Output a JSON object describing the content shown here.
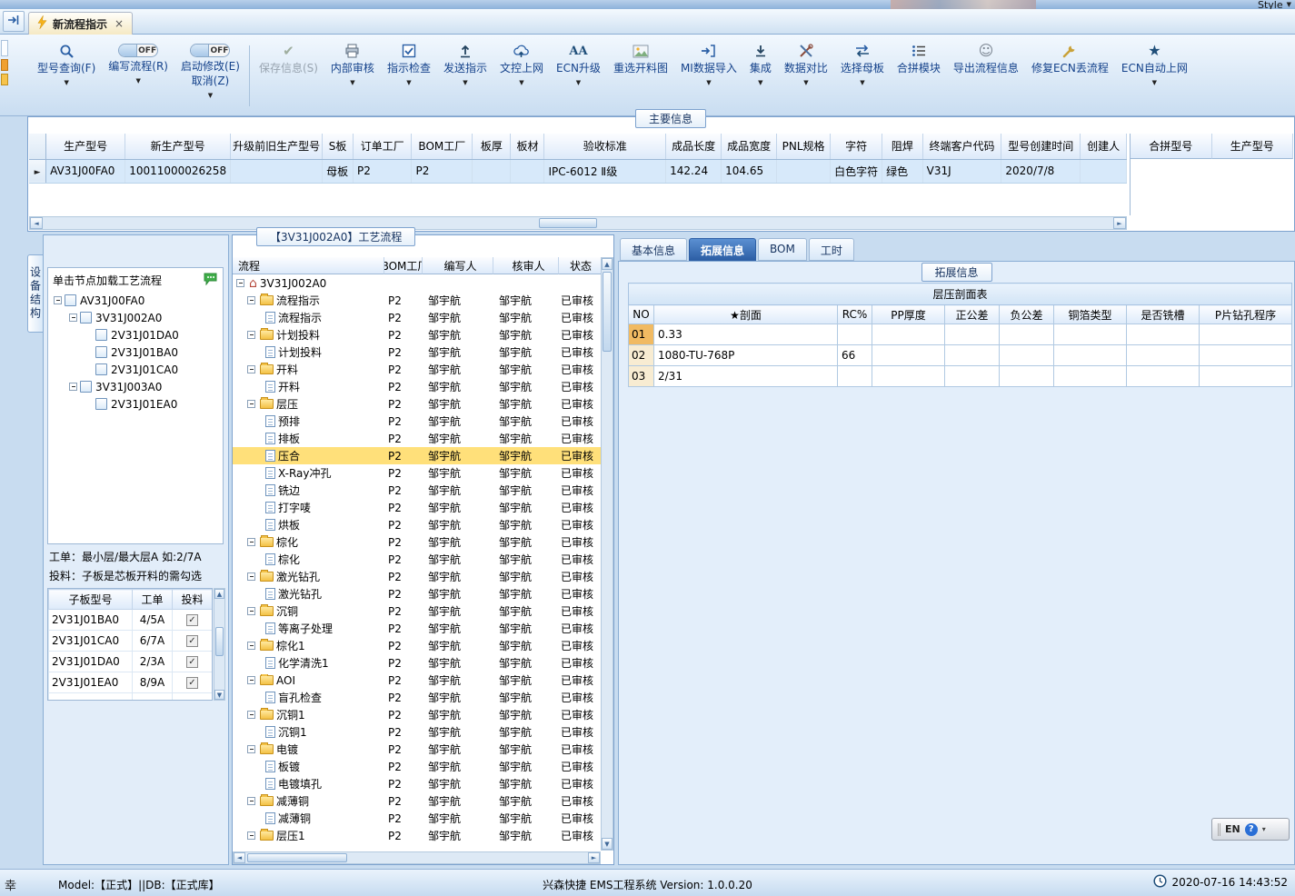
{
  "colors": {
    "accent_blue": "#2d5fa5",
    "panel_border": "#7da2ce",
    "toolbar_text": "#15428b",
    "selection_yellow": "#ffe07a",
    "active_tab_blue": "#3b6db0",
    "no_cell_orange": "#f1ba62",
    "comment_green": "#3fae49"
  },
  "icons": {
    "lightning-icon": "bolt",
    "comment-icon": "speech-bubble",
    "clock-icon": "clock",
    "chevron-down-icon": "▼",
    "row-marker-icon": "►"
  },
  "window": {
    "style_label": "Style"
  },
  "tab_bar": {
    "active_tab": "新流程指示",
    "close_icon": "×"
  },
  "toolbar": {
    "buttons": [
      {
        "id": "model-query",
        "label": "型号查询(F)",
        "icon": "search-icon",
        "dropdown": true
      },
      {
        "id": "write-flow",
        "label": "编写流程(R)",
        "toggle": "OFF",
        "dropdown": true
      },
      {
        "id": "start-modify",
        "label": "启动修改(E)",
        "label2": "取消(Z)",
        "toggle": "OFF",
        "dropdown": true,
        "sep_after": true
      },
      {
        "id": "save-info",
        "label": "保存信息(S)",
        "icon": "save-check-icon",
        "disabled": true
      },
      {
        "id": "internal-audit",
        "label": "内部审核",
        "icon": "printer-icon",
        "dropdown": true
      },
      {
        "id": "instruction-check",
        "label": "指示检查",
        "icon": "checkbox-icon",
        "dropdown": true
      },
      {
        "id": "send-instruction",
        "label": "发送指示",
        "icon": "upload-icon",
        "dropdown": true
      },
      {
        "id": "doc-upload",
        "label": "文控上网",
        "icon": "cloud-upload-icon",
        "dropdown": true
      },
      {
        "id": "ecn-upgrade",
        "label": "ECN升级",
        "icon": "font-icon",
        "dropdown": true
      },
      {
        "id": "reselect-cut-image",
        "label": "重选开料图",
        "icon": "image-icon"
      },
      {
        "id": "mi-data-import",
        "label": "MI数据导入",
        "icon": "import-icon",
        "dropdown": true
      },
      {
        "id": "integrate",
        "label": "集成",
        "icon": "download-icon",
        "dropdown": true
      },
      {
        "id": "data-compare",
        "label": "数据对比",
        "icon": "tools-icon",
        "dropdown": true
      },
      {
        "id": "select-mother-board",
        "label": "选择母板",
        "icon": "swap-icon",
        "dropdown": true
      },
      {
        "id": "merge-module",
        "label": "合拼模块",
        "icon": "list-icon"
      },
      {
        "id": "export-flow-info",
        "label": "导出流程信息",
        "icon": "smiley-icon"
      },
      {
        "id": "repair-ecn-flow",
        "label": "修复ECN丢流程",
        "icon": "wrench-icon"
      },
      {
        "id": "ecn-auto-upload",
        "label": "ECN自动上网",
        "icon": "star-icon",
        "dropdown": true
      }
    ]
  },
  "main_info": {
    "caption": "主要信息",
    "columns": [
      "生产型号",
      "新生产型号",
      "升级前旧生产型号",
      "S板",
      "订单工厂",
      "BOM工厂",
      "板厚",
      "板材",
      "验收标准",
      "成品长度",
      "成品宽度",
      "PNL规格",
      "字符",
      "阻焊",
      "终端客户代码",
      "型号创建时间",
      "创建人"
    ],
    "row": [
      "AV31J00FA0",
      "10011000026258",
      "",
      "母板",
      "P2",
      "P2",
      "",
      "",
      "IPC-6012 Ⅱ级",
      "142.24",
      "104.65",
      "",
      "白色字符",
      "绿色",
      "V31J",
      "2020/7/8",
      ""
    ],
    "right_columns": [
      "合拼型号",
      "生产型号"
    ]
  },
  "device_panel": {
    "vertical_tab": "设备结构",
    "hint": "单击节点加载工艺流程",
    "tree": [
      {
        "label": "AV31J00FA0",
        "level": 0,
        "expanded": true
      },
      {
        "label": "3V31J002A0",
        "level": 1,
        "expanded": true
      },
      {
        "label": "2V31J01DA0",
        "level": 2
      },
      {
        "label": "2V31J01BA0",
        "level": 2
      },
      {
        "label": "2V31J01CA0",
        "level": 2
      },
      {
        "label": "3V31J003A0",
        "level": 1,
        "expanded": true
      },
      {
        "label": "2V31J01EA0",
        "level": 2
      }
    ],
    "notes": [
      "工单：最小层/最大层A 如:2/7A",
      "投料：子板是芯板开料的需勾选"
    ],
    "subboard_table": {
      "columns": [
        "子板型号",
        "工单",
        "投料"
      ],
      "rows": [
        {
          "model": "2V31J01BA0",
          "order": "4/5A",
          "feed": true
        },
        {
          "model": "2V31J01CA0",
          "order": "6/7A",
          "feed": true
        },
        {
          "model": "2V31J01DA0",
          "order": "2/3A",
          "feed": true
        },
        {
          "model": "2V31J01EA0",
          "order": "8/9A",
          "feed": true
        }
      ]
    }
  },
  "process_panel": {
    "caption": "【3V31J002A0】工艺流程",
    "columns": [
      "流程",
      "BOM工厂",
      "编写人",
      "核审人",
      "状态"
    ],
    "rows": [
      {
        "type": "root",
        "label": "3V31J002A0",
        "level": 0,
        "bom": "",
        "writer": "",
        "auditor": "",
        "status": ""
      },
      {
        "type": "folder",
        "label": "流程指示",
        "level": 1,
        "bom": "P2",
        "writer": "邹宇航",
        "auditor": "邹宇航",
        "status": "已审核"
      },
      {
        "type": "item",
        "label": "流程指示",
        "level": 2,
        "bom": "P2",
        "writer": "邹宇航",
        "auditor": "邹宇航",
        "status": "已审核"
      },
      {
        "type": "folder",
        "label": "计划投料",
        "level": 1,
        "bom": "P2",
        "writer": "邹宇航",
        "auditor": "邹宇航",
        "status": "已审核"
      },
      {
        "type": "item",
        "label": "计划投料",
        "level": 2,
        "bom": "P2",
        "writer": "邹宇航",
        "auditor": "邹宇航",
        "status": "已审核"
      },
      {
        "type": "folder",
        "label": "开料",
        "level": 1,
        "bom": "P2",
        "writer": "邹宇航",
        "auditor": "邹宇航",
        "status": "已审核"
      },
      {
        "type": "item",
        "label": "开料",
        "level": 2,
        "bom": "P2",
        "writer": "邹宇航",
        "auditor": "邹宇航",
        "status": "已审核"
      },
      {
        "type": "folder",
        "label": "层压",
        "level": 1,
        "bom": "P2",
        "writer": "邹宇航",
        "auditor": "邹宇航",
        "status": "已审核"
      },
      {
        "type": "item",
        "label": "预排",
        "level": 2,
        "bom": "P2",
        "writer": "邹宇航",
        "auditor": "邹宇航",
        "status": "已审核"
      },
      {
        "type": "item",
        "label": "排板",
        "level": 2,
        "bom": "P2",
        "writer": "邹宇航",
        "auditor": "邹宇航",
        "status": "已审核"
      },
      {
        "type": "item",
        "label": "压合",
        "level": 2,
        "selected": true,
        "bom": "P2",
        "writer": "邹宇航",
        "auditor": "邹宇航",
        "status": "已审核"
      },
      {
        "type": "item",
        "label": "X-Ray冲孔",
        "level": 2,
        "bom": "P2",
        "writer": "邹宇航",
        "auditor": "邹宇航",
        "status": "已审核"
      },
      {
        "type": "item",
        "label": "铣边",
        "level": 2,
        "bom": "P2",
        "writer": "邹宇航",
        "auditor": "邹宇航",
        "status": "已审核"
      },
      {
        "type": "item",
        "label": "打字唛",
        "level": 2,
        "bom": "P2",
        "writer": "邹宇航",
        "auditor": "邹宇航",
        "status": "已审核"
      },
      {
        "type": "item",
        "label": "烘板",
        "level": 2,
        "bom": "P2",
        "writer": "邹宇航",
        "auditor": "邹宇航",
        "status": "已审核"
      },
      {
        "type": "folder",
        "label": "棕化",
        "level": 1,
        "bom": "P2",
        "writer": "邹宇航",
        "auditor": "邹宇航",
        "status": "已审核"
      },
      {
        "type": "item",
        "label": "棕化",
        "level": 2,
        "bom": "P2",
        "writer": "邹宇航",
        "auditor": "邹宇航",
        "status": "已审核"
      },
      {
        "type": "folder",
        "label": "激光钻孔",
        "level": 1,
        "bom": "P2",
        "writer": "邹宇航",
        "auditor": "邹宇航",
        "status": "已审核"
      },
      {
        "type": "item",
        "label": "激光钻孔",
        "level": 2,
        "bom": "P2",
        "writer": "邹宇航",
        "auditor": "邹宇航",
        "status": "已审核"
      },
      {
        "type": "folder",
        "label": "沉铜",
        "level": 1,
        "bom": "P2",
        "writer": "邹宇航",
        "auditor": "邹宇航",
        "status": "已审核"
      },
      {
        "type": "item",
        "label": "等离子处理",
        "level": 2,
        "bom": "P2",
        "writer": "邹宇航",
        "auditor": "邹宇航",
        "status": "已审核"
      },
      {
        "type": "folder",
        "label": "棕化1",
        "level": 1,
        "bom": "P2",
        "writer": "邹宇航",
        "auditor": "邹宇航",
        "status": "已审核"
      },
      {
        "type": "item",
        "label": "化学清洗1",
        "level": 2,
        "bom": "P2",
        "writer": "邹宇航",
        "auditor": "邹宇航",
        "status": "已审核"
      },
      {
        "type": "folder",
        "label": "AOI",
        "level": 1,
        "bom": "P2",
        "writer": "邹宇航",
        "auditor": "邹宇航",
        "status": "已审核"
      },
      {
        "type": "item",
        "label": "盲孔检查",
        "level": 2,
        "bom": "P2",
        "writer": "邹宇航",
        "auditor": "邹宇航",
        "status": "已审核"
      },
      {
        "type": "folder",
        "label": "沉铜1",
        "level": 1,
        "bom": "P2",
        "writer": "邹宇航",
        "auditor": "邹宇航",
        "status": "已审核"
      },
      {
        "type": "item",
        "label": "沉铜1",
        "level": 2,
        "bom": "P2",
        "writer": "邹宇航",
        "auditor": "邹宇航",
        "status": "已审核"
      },
      {
        "type": "folder",
        "label": "电镀",
        "level": 1,
        "bom": "P2",
        "writer": "邹宇航",
        "auditor": "邹宇航",
        "status": "已审核"
      },
      {
        "type": "item",
        "label": "板镀",
        "level": 2,
        "bom": "P2",
        "writer": "邹宇航",
        "auditor": "邹宇航",
        "status": "已审核"
      },
      {
        "type": "item",
        "label": "电镀填孔",
        "level": 2,
        "bom": "P2",
        "writer": "邹宇航",
        "auditor": "邹宇航",
        "status": "已审核"
      },
      {
        "type": "folder",
        "label": "减薄铜",
        "level": 1,
        "bom": "P2",
        "writer": "邹宇航",
        "auditor": "邹宇航",
        "status": "已审核"
      },
      {
        "type": "item",
        "label": "减薄铜",
        "level": 2,
        "bom": "P2",
        "writer": "邹宇航",
        "auditor": "邹宇航",
        "status": "已审核"
      },
      {
        "type": "folder",
        "label": "层压1",
        "level": 1,
        "bom": "P2",
        "writer": "邹宇航",
        "auditor": "邹宇航",
        "status": "已审核"
      }
    ]
  },
  "detail_panel": {
    "tabs": [
      "基本信息",
      "拓展信息",
      "BOM",
      "工时"
    ],
    "active_tab": "拓展信息",
    "caption": "拓展信息",
    "lamination_table": {
      "title": "层压剖面表",
      "columns": [
        "NO",
        "★剖面",
        "RC%",
        "PP厚度",
        "正公差",
        "负公差",
        "铜箔类型",
        "是否铣槽",
        "P片钻孔程序"
      ],
      "rows": [
        [
          "01",
          "0.33",
          "",
          "",
          "",
          "",
          "",
          "",
          ""
        ],
        [
          "02",
          "1080-TU-768P",
          "66",
          "",
          "",
          "",
          "",
          "",
          ""
        ],
        [
          "03",
          "2/31",
          "",
          "",
          "",
          "",
          "",
          "",
          ""
        ]
      ]
    },
    "language_bar": {
      "text": "EN",
      "help": "?"
    }
  },
  "status_bar": {
    "left_char": "幸",
    "model_db": "Model:【正式】||DB:【正式库】",
    "center": "兴森快捷 EMS工程系统 Version: 1.0.0.20",
    "datetime": "2020-07-16 14:43:52"
  }
}
